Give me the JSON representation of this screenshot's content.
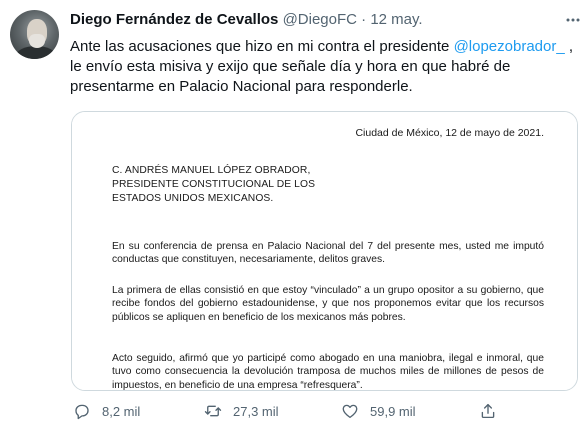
{
  "author": {
    "name": "Diego Fernández de Cevallos",
    "handle": "@DiegoFC",
    "separator": "·",
    "date": "12 may."
  },
  "tweet": {
    "text_before": "Ante las acusaciones que hizo en mi contra el presidente ",
    "mention": "@lopezobrador_",
    "text_after": " , le envío esta misiva y exijo que señale día y hora en que habré de presentarme en Palacio Nacional para responderle."
  },
  "letter": {
    "date": "Ciudad de México, 12 de mayo de 2021.",
    "recipient": [
      "C. ANDRÉS MANUEL LÓPEZ OBRADOR,",
      "PRESIDENTE CONSTITUCIONAL DE LOS",
      "ESTADOS UNIDOS MEXICANOS."
    ],
    "paragraphs": [
      "En su conferencia de prensa en Palacio Nacional del 7 del presente mes, usted me imputó conductas que constituyen, necesariamente, delitos graves.",
      "La primera de ellas consistió en que estoy “vinculado” a un grupo opositor a su gobierno, que recibe fondos del gobierno estadounidense, y que nos proponemos evitar que los recursos públicos se apliquen en beneficio de los mexicanos más pobres.",
      "Acto seguido, afirmó que yo participé como abogado en una maniobra, ilegal e inmoral, que tuvo como consecuencia la devolución tramposa de muchos miles de millones de pesos de impuestos, en beneficio de una empresa “refresquera”."
    ]
  },
  "actions": {
    "replies": "8,2 mil",
    "retweets": "27,3 mil",
    "likes": "59,9 mil"
  },
  "colors": {
    "text": "#0f1419",
    "secondary": "#536471",
    "link": "#1d9bf0",
    "border": "#cfd9de"
  },
  "icons": [
    "more-icon",
    "reply-icon",
    "retweet-icon",
    "like-icon",
    "share-icon"
  ]
}
